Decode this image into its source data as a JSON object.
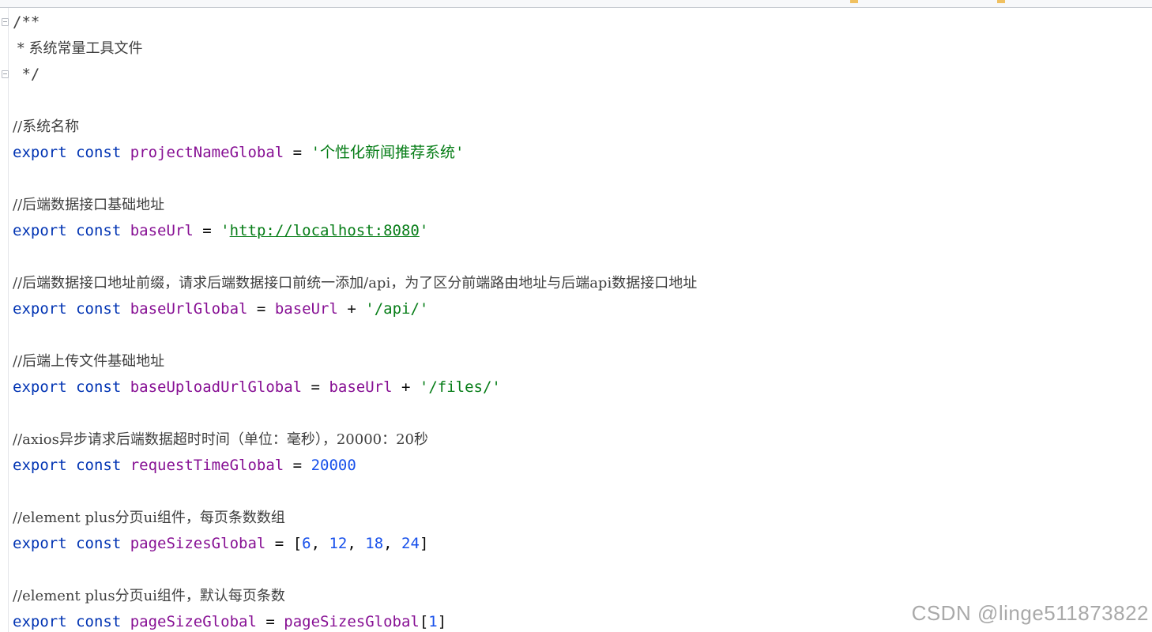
{
  "colors": {
    "keyword": "#0033b3",
    "identifier": "#871094",
    "string": "#067d17",
    "number": "#1750eb",
    "comment": "#3f3f3f",
    "operator": "#080808"
  },
  "doc_comment": {
    "open": "/**",
    "text": " * 系统常量工具文件",
    "close": " */"
  },
  "blocks": [
    {
      "comment": "//系统名称",
      "keyword": "export const",
      "name": "projectNameGlobal",
      "op": "=",
      "value": "'个性化新闻推荐系统'"
    },
    {
      "comment": "//后端数据接口基础地址",
      "keyword": "export const",
      "name": "baseUrl",
      "op": "=",
      "value_prefix": "'",
      "value_url": "http://localhost:8080",
      "value_suffix": "'"
    },
    {
      "comment": "//后端数据接口地址前缀，请求后端数据接口前统一添加/api，为了区分前端路由地址与后端api数据接口地址",
      "keyword": "export const",
      "name": "baseUrlGlobal",
      "op": "=",
      "ref": "baseUrl",
      "plus": "+",
      "value": "'/api/'"
    },
    {
      "comment": "//后端上传文件基础地址",
      "keyword": "export const",
      "name": "baseUploadUrlGlobal",
      "op": "=",
      "ref": "baseUrl",
      "plus": "+",
      "value": "'/files/'"
    },
    {
      "comment": "//axios异步请求后端数据超时时间（单位：毫秒），20000：20秒",
      "keyword": "export const",
      "name": "requestTimeGlobal",
      "op": "=",
      "number": "20000"
    },
    {
      "comment": "//element plus分页ui组件，每页条数数组",
      "keyword": "export const",
      "name": "pageSizesGlobal",
      "op": "=",
      "array": [
        "6",
        "12",
        "18",
        "24"
      ]
    },
    {
      "comment": "//element plus分页ui组件，默认每页条数",
      "keyword": "export const",
      "name": "pageSizeGlobal",
      "op": "=",
      "ref": "pageSizesGlobal",
      "index": "1"
    }
  ],
  "watermark": "CSDN @linge511873822"
}
